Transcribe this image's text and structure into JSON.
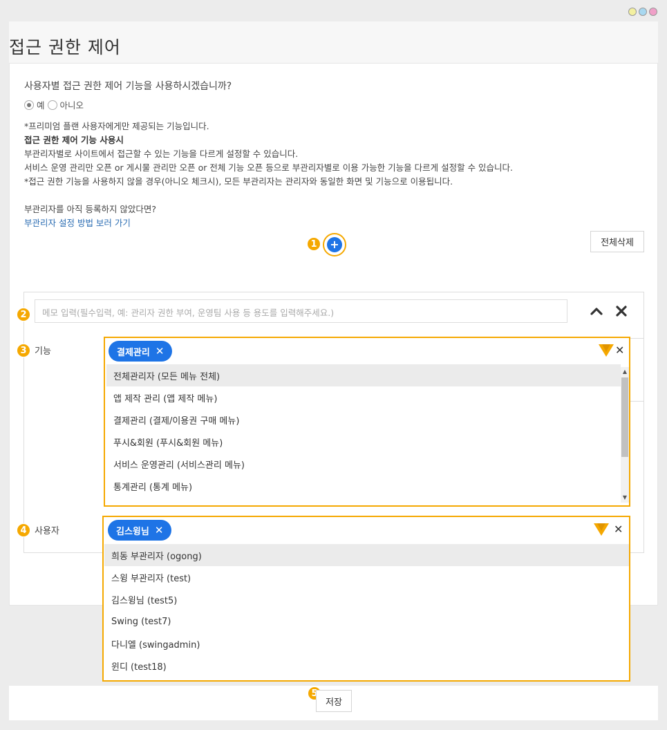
{
  "window": {
    "dot_colors": [
      "#f3f0a0",
      "#a8d8f0",
      "#f0a0c8"
    ]
  },
  "header": {
    "title": "접근 권한 제어"
  },
  "settings": {
    "question": "사용자별 접근 권한 제어 기능을 사용하시겠습니까?",
    "options": [
      {
        "label": "예",
        "checked": true
      },
      {
        "label": "아니오",
        "checked": false
      }
    ],
    "info_lines": [
      "*프리미엄 플랜 사용자에게만 제공되는 기능입니다.",
      "접근 권한 제어 기능 사용시",
      "부관리자별로 사이트에서 접근할 수 있는 기능을 다르게 설정할 수 있습니다.",
      "서비스 운영 관리만 오픈 or 게시물 관리만 오픈 or 전체 기능 오픈 등으로 부관리자별로 이용 가능한 기능을 다르게 설정할 수 있습니다.",
      "*접근 권한 기능을 사용하지 않을 경우(아니오 체크시), 모든 부관리자는 관리자와 동일한 화면 및 기능으로 이용됩니다."
    ],
    "unregistered_text": "부관리자를 아직 등록하지 않았다면?",
    "guide_link": "부관리자 설정 방법 보러 가기"
  },
  "toolbar": {
    "add_icon": "plus-icon",
    "delete_all_label": "전체삭제"
  },
  "badges": [
    "1",
    "2",
    "3",
    "4",
    "5"
  ],
  "rule": {
    "memo_placeholder": "메모 입력(필수입력, 예: 관리자 권한 부여, 운영팀 사용 등 용도를 입력해주세요.)",
    "function_label": "기능",
    "user_label": "사용자",
    "function_selected": "결제관리",
    "function_options": [
      "전체관리자 (모든 메뉴 전체)",
      "앱 제작 관리 (앱 제작 메뉴)",
      "결제관리 (결제/이용권 구매 메뉴)",
      "푸시&회원 (푸시&회원 메뉴)",
      "서비스 운영관리 (서비스관리 메뉴)",
      "통계관리 (통계 메뉴)"
    ],
    "user_selected": "김스윙님",
    "user_options": [
      "희동 부관리자 (ogong)",
      "스윙 부관리자 (test)",
      "김스윙님 (test5)",
      "Swing (test7)",
      "다니엘 (swingadmin)",
      "윈디 (test18)"
    ]
  },
  "footer": {
    "save_label": "저장"
  },
  "colors": {
    "accent": "#f5a800",
    "primary": "#1e74e6",
    "link": "#2b6db3"
  }
}
